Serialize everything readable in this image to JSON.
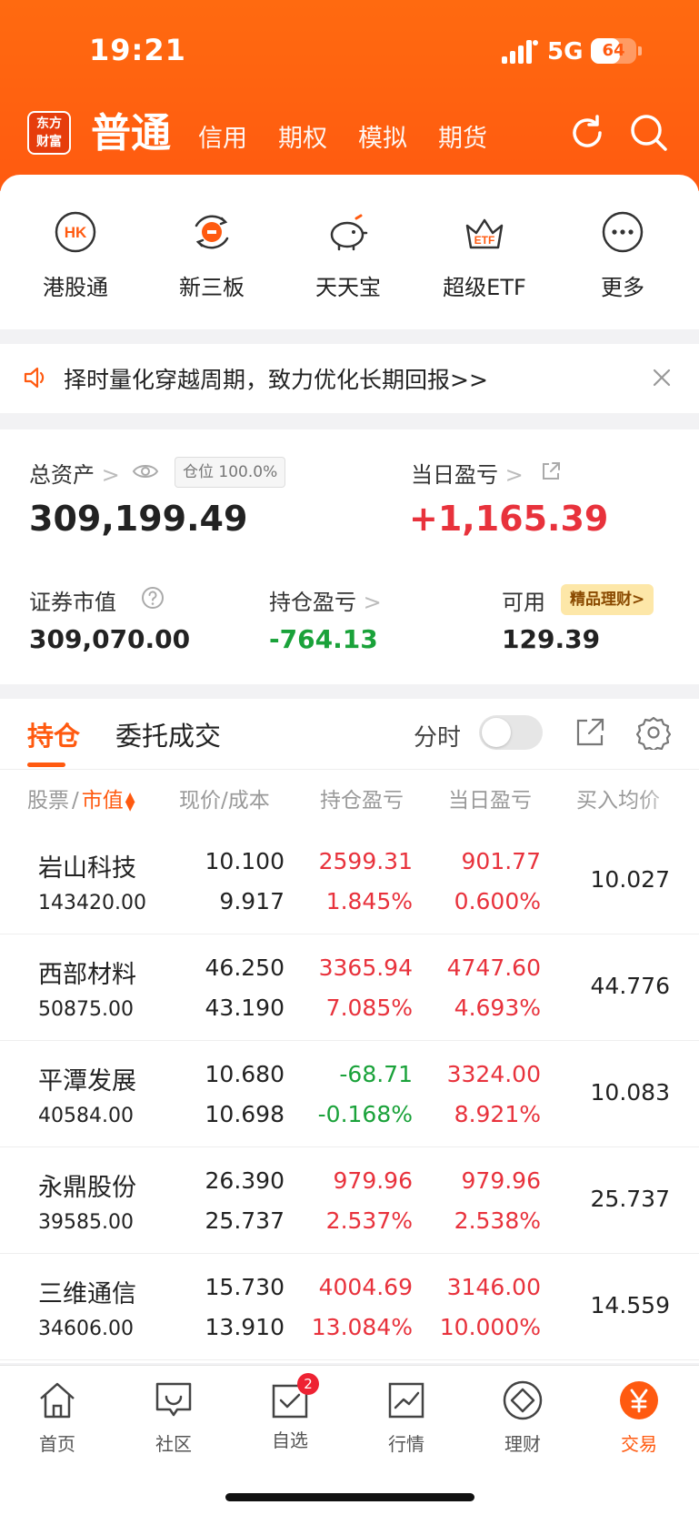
{
  "status_bar": {
    "time": "19:21",
    "network": "5G",
    "battery": "64",
    "battery_level": 0.64
  },
  "header": {
    "logo_text": "东方财富",
    "active_tab": "普通",
    "tabs": [
      "信用",
      "期权",
      "模拟",
      "期货"
    ],
    "accent_color": "#ff5a10"
  },
  "shortcuts": [
    {
      "label": "港股通",
      "icon": "hk-icon"
    },
    {
      "label": "新三板",
      "icon": "new-board-icon"
    },
    {
      "label": "天天宝",
      "icon": "piggy-bank-icon"
    },
    {
      "label": "超级ETF",
      "icon": "etf-crown-icon"
    },
    {
      "label": "更多",
      "icon": "more-icon"
    }
  ],
  "notice": {
    "text": "择时量化穿越周期，致力优化长期回报>>"
  },
  "assets": {
    "total_label": "总资产",
    "position_badge": "仓位 100.0%",
    "total_value": "309,199.49",
    "daily_pl_label": "当日盈亏",
    "daily_pl_value": "+1,165.39",
    "market_value_label": "证券市值",
    "market_value": "309,070.00",
    "holding_pl_label": "持仓盈亏",
    "holding_pl_value": "-764.13",
    "available_label": "可用",
    "available_value": "129.39",
    "wealth_badge": "精品理财>"
  },
  "holdings": {
    "active_tab": "持仓",
    "tab2": "委托成交",
    "timeshare_label": "分时",
    "col_stock": "股票",
    "col_sep": "/",
    "col_mv": "市值",
    "col_price": "现价/成本",
    "col_hold_pl": "持仓盈亏",
    "col_day_pl": "当日盈亏",
    "col_avg": "买入均价",
    "rows": [
      {
        "name": "岩山科技",
        "mv": "143420.00",
        "price": "10.100",
        "cost": "9.917",
        "hold_pl": "2599.31",
        "hold_pct": "1.845%",
        "day_pl": "901.77",
        "day_pct": "0.600%",
        "avg": "10.027",
        "hold_up": true,
        "day_up": true
      },
      {
        "name": "西部材料",
        "mv": "50875.00",
        "price": "46.250",
        "cost": "43.190",
        "hold_pl": "3365.94",
        "hold_pct": "7.085%",
        "day_pl": "4747.60",
        "day_pct": "4.693%",
        "avg": "44.776",
        "hold_up": true,
        "day_up": true
      },
      {
        "name": "平潭发展",
        "mv": "40584.00",
        "price": "10.680",
        "cost": "10.698",
        "hold_pl": "-68.71",
        "hold_pct": "-0.168%",
        "day_pl": "3324.00",
        "day_pct": "8.921%",
        "avg": "10.083",
        "hold_up": false,
        "day_up": true
      },
      {
        "name": "永鼎股份",
        "mv": "39585.00",
        "price": "26.390",
        "cost": "25.737",
        "hold_pl": "979.96",
        "hold_pct": "2.537%",
        "day_pl": "979.96",
        "day_pct": "2.538%",
        "avg": "25.737",
        "hold_up": true,
        "day_up": true
      },
      {
        "name": "三维通信",
        "mv": "34606.00",
        "price": "15.730",
        "cost": "13.910",
        "hold_pl": "4004.69",
        "hold_pct": "13.084%",
        "day_pl": "3146.00",
        "day_pct": "10.000%",
        "avg": "14.559",
        "hold_up": true,
        "day_up": true
      }
    ]
  },
  "nav": [
    {
      "label": "首页",
      "icon": "home-icon"
    },
    {
      "label": "社区",
      "icon": "community-icon"
    },
    {
      "label": "自选",
      "icon": "watchlist-icon",
      "badge": "2"
    },
    {
      "label": "行情",
      "icon": "market-chart-icon"
    },
    {
      "label": "理财",
      "icon": "wealth-icon"
    },
    {
      "label": "交易",
      "icon": "trade-yen-icon",
      "active": true
    }
  ]
}
